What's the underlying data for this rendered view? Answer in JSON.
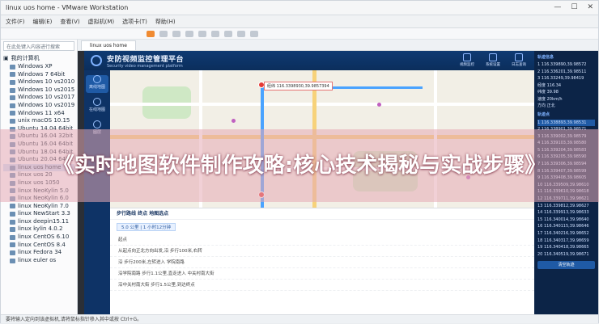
{
  "window": {
    "title": "linux uos home - VMware Workstation",
    "controls": [
      "—",
      "☐",
      "✕"
    ]
  },
  "menu": [
    "文件(F)",
    "编辑(E)",
    "查看(V)",
    "虚拟机(M)",
    "选项卡(T)",
    "帮助(H)"
  ],
  "library": {
    "search_placeholder": "在此处键入内容进行搜索",
    "root_label": "我的计算机",
    "items": [
      "Windows XP",
      "Windows 7 64bit",
      "Windows 10 vs2010",
      "Windows 10 vs2015",
      "Windows 10 vs2017",
      "Windows 10 vs2019",
      "Windows 11 x64",
      "unix macOS 10.15",
      "Ubuntu 14.04 64bit",
      "Ubuntu 16.04 32bit",
      "Ubuntu 16.04 64bit",
      "Ubuntu 18.04 64bit",
      "Ubuntu 20.04 64bit",
      "linux uos home",
      "linux uos 20",
      "linux uos 1050",
      "linux NeoKylin 5.0",
      "linux NeoKylin 6.0",
      "linux NeoKylin 7.0",
      "linux NewStart 3.3",
      "linux deepin15.11",
      "linux kylin 4.0.2",
      "linux CentOS 6.10",
      "linux CentOS 8.4",
      "linux Fedora 34",
      "linux euler os"
    ],
    "selected_index": 13
  },
  "tab": {
    "label": "linux uos home"
  },
  "app": {
    "title": "安防视频监控管理平台",
    "subtitle": "Security video management platform",
    "header_icons": [
      {
        "label": "视频监控",
        "icon": "camera-icon"
      },
      {
        "label": "系统设置",
        "icon": "settings-icon"
      },
      {
        "label": "日志查询",
        "icon": "log-icon"
      }
    ],
    "nav": [
      {
        "label": "离线地图",
        "icon": "map-icon"
      },
      {
        "label": "在线地图",
        "icon": "globe-icon"
      },
      {
        "label": "图层",
        "icon": "layers-icon"
      }
    ],
    "map": {
      "popup": "经纬 116.3398930,39.9857394"
    },
    "route": {
      "heading": "步行路线  终点 地图选点",
      "distance_chip": "5.0 公里 | 1 小时12分钟",
      "steps": [
        "起点",
        "从起点向正北方向出发,沿 步行100米,右转",
        "沿 步行200米,左转进入 学院南路",
        "沿学院南路 步行1.1公里,直走进入 中关村南大街",
        "沿中关村南大街 步行1.5公里,到达终点"
      ]
    },
    "right": {
      "info_title": "轨迹信息",
      "kv": [
        "1 116.339890,39.98572",
        "2 116.336201,39.98511",
        "3 116.33249,39.98419",
        "经度 116.34",
        "纬度 39.98",
        "速度 20km/h",
        "方向 正北"
      ],
      "coords_title": "轨迹点",
      "coords": [
        "1  116.338893,39.98531",
        "2  116.338901,39.98571",
        "3  116.339002,39.98579",
        "4  116.339103,39.98580",
        "5  116.339204,39.98583",
        "6  116.339205,39.98590",
        "7  116.339306,39.98594",
        "8  116.339407,39.98599",
        "9  116.339408,39.98605",
        "10 116.339509,39.98610",
        "11 116.339610,39.98618",
        "12 116.339711,39.98621",
        "13 116.339812,39.98627",
        "14 116.339913,39.98633",
        "15 116.340014,39.98640",
        "16 116.340115,39.98646",
        "17 116.340216,39.98652",
        "18 116.340317,39.98659",
        "19 116.340418,39.98665",
        "20 116.340519,39.98671"
      ],
      "highlight_index": 0,
      "button": "清空轨迹"
    }
  },
  "status": {
    "text": "要将输入定向到该虚拟机,请将鼠标指针移入其中或按 Ctrl+G。"
  },
  "banner": {
    "text": "《实时地图软件制作攻略:核心技术揭秘与实战步骤》"
  }
}
